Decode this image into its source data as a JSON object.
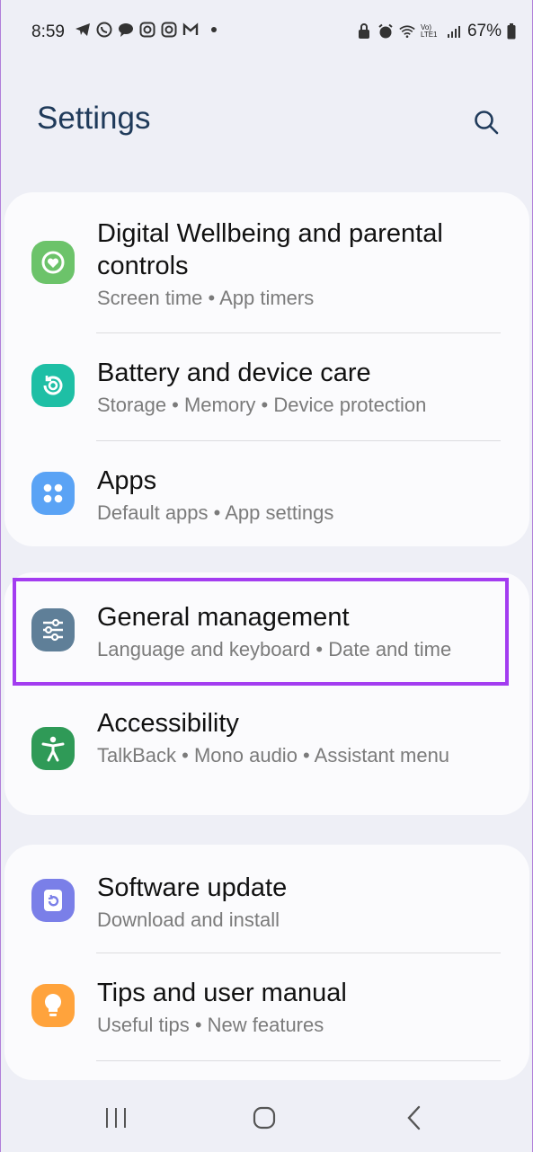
{
  "status_bar": {
    "time": "8:59",
    "battery": "67%",
    "left_icons": [
      "telegram-icon",
      "whatsapp-icon",
      "chat-icon",
      "instagram-icon",
      "instagram-icon",
      "gmail-icon"
    ],
    "right_icons": [
      "lock-icon",
      "alarm-icon",
      "wifi-icon",
      "volte-icon",
      "signal-icon",
      "battery-icon"
    ],
    "volte_label": "Vo) LTE1"
  },
  "header": {
    "title": "Settings"
  },
  "items": [
    {
      "title": "Digital Wellbeing and parental controls",
      "subtitle": "Screen time  •  App timers",
      "icon": "wellbeing-icon",
      "color": "#6cc36a"
    },
    {
      "title": "Battery and device care",
      "subtitle": "Storage  •  Memory  •  Device protection",
      "icon": "device-care-icon",
      "color": "#1ebfa5"
    },
    {
      "title": "Apps",
      "subtitle": "Default apps  •  App settings",
      "icon": "apps-icon",
      "color": "#5aa3f5"
    },
    {
      "title": "General management",
      "subtitle": "Language and keyboard  •  Date and time",
      "icon": "sliders-icon",
      "color": "#5f7f98"
    },
    {
      "title": "Accessibility",
      "subtitle": "TalkBack  •  Mono audio  •  Assistant menu",
      "icon": "accessibility-icon",
      "color": "#2f9a57"
    },
    {
      "title": "Software update",
      "subtitle": "Download and install",
      "icon": "update-icon",
      "color": "#7a7fe8"
    },
    {
      "title": "Tips and user manual",
      "subtitle": "Useful tips  •  New features",
      "icon": "bulb-icon",
      "color": "#ffa33c"
    }
  ],
  "highlight": {
    "color": "#a33cf0",
    "target": "General management"
  },
  "nav": {
    "recents": "recents-icon",
    "home": "home-icon",
    "back": "back-icon"
  }
}
